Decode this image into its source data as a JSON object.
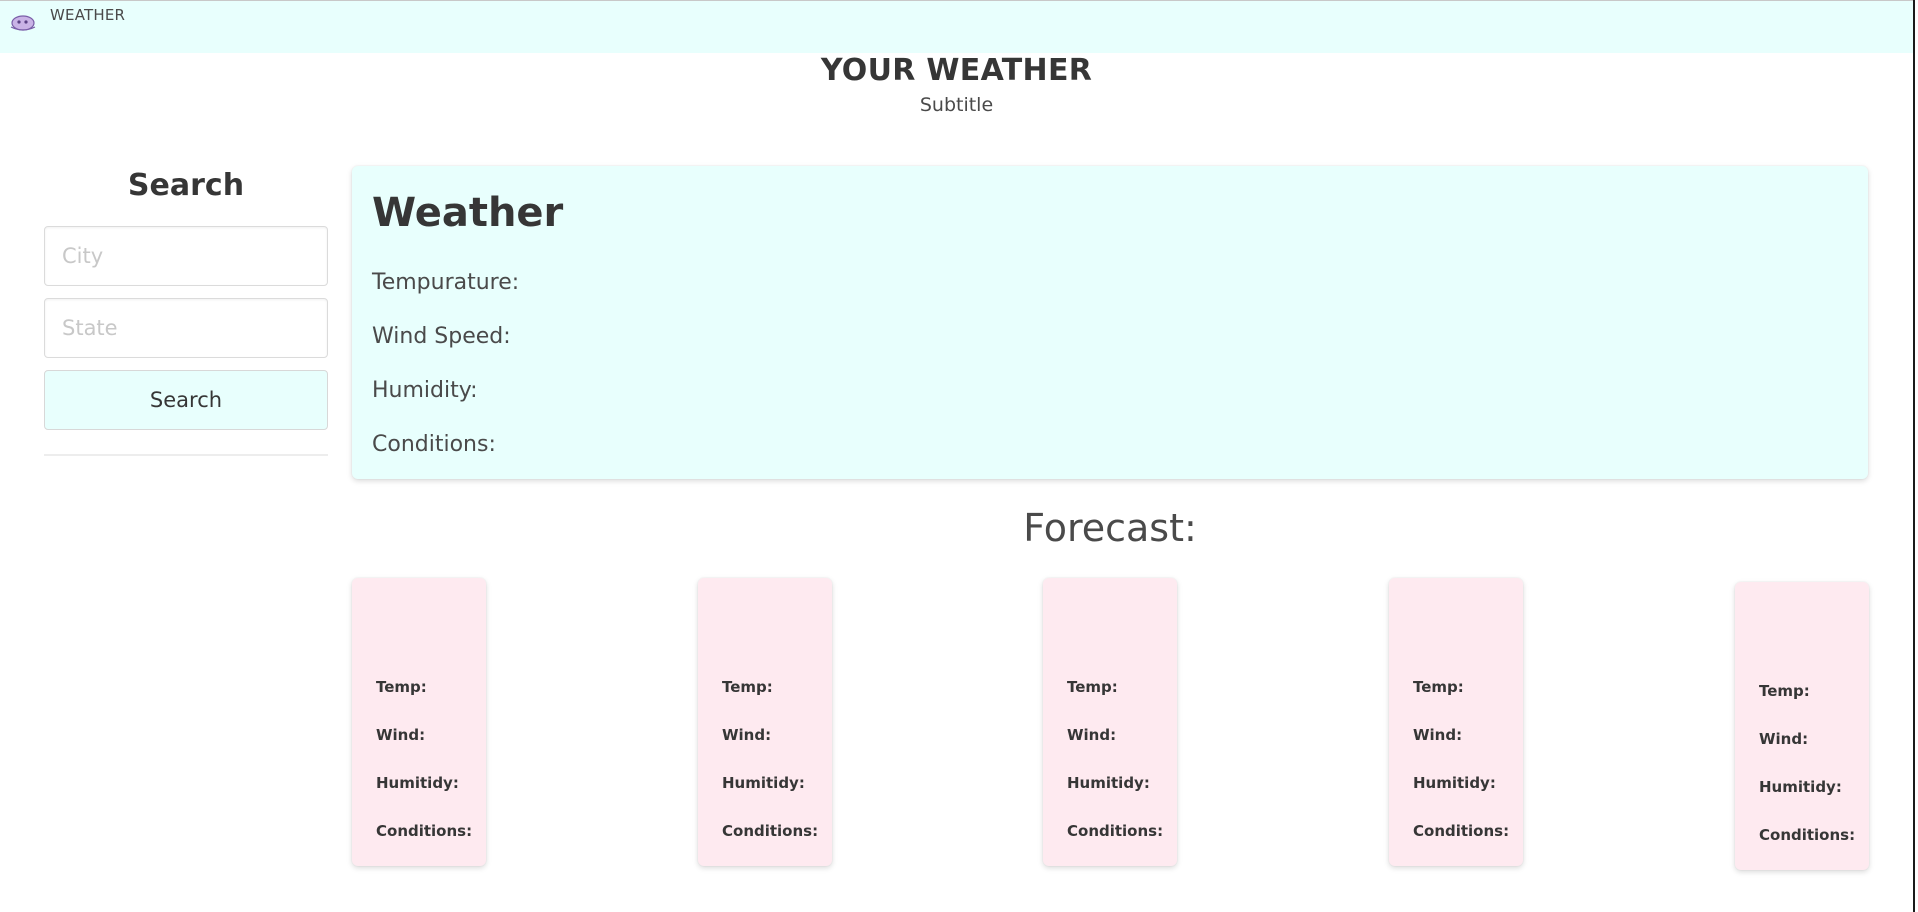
{
  "navbar": {
    "logo_icon": "weather-logo-icon",
    "title": "WEATHER"
  },
  "hero": {
    "title": "YOUR WEATHER",
    "subtitle": "Subtitle"
  },
  "search": {
    "heading": "Search",
    "city_placeholder": "City",
    "city_value": "",
    "state_placeholder": "State",
    "state_value": "",
    "button_label": "Search"
  },
  "current_weather": {
    "title": "Weather",
    "temperature_label": "Tempurature:",
    "wind_speed_label": "Wind Speed:",
    "humidity_label": "Humidity:",
    "conditions_label": "Conditions:"
  },
  "forecast": {
    "heading": "Forecast:",
    "cards": [
      {
        "temp_label": "Temp:",
        "wind_label": "Wind:",
        "humidity_label": "Humitidy:",
        "conditions_label": "Conditions:"
      },
      {
        "temp_label": "Temp:",
        "wind_label": "Wind:",
        "humidity_label": "Humitidy:",
        "conditions_label": "Conditions:"
      },
      {
        "temp_label": "Temp:",
        "wind_label": "Wind:",
        "humidity_label": "Humitidy:",
        "conditions_label": "Conditions:"
      },
      {
        "temp_label": "Temp:",
        "wind_label": "Wind:",
        "humidity_label": "Humitidy:",
        "conditions_label": "Conditions:"
      },
      {
        "temp_label": "Temp:",
        "wind_label": "Wind:",
        "humidity_label": "Humitidy:",
        "conditions_label": "Conditions:"
      }
    ]
  },
  "colors": {
    "navbar_bg": "#e8fffd",
    "weather_card_bg": "#e8fffd",
    "forecast_card_bg": "#feeaf0",
    "button_bg": "#e8fffd"
  }
}
